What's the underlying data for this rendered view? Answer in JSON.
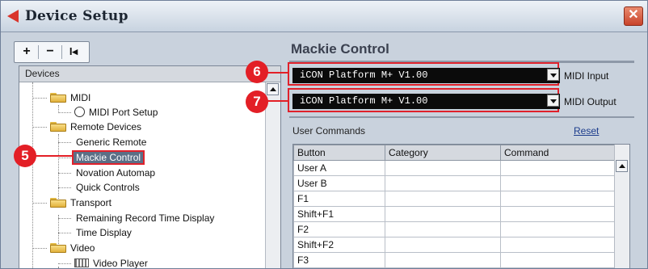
{
  "window": {
    "title": "Device Setup",
    "close_icon": "close-icon"
  },
  "toolbar": {
    "add_label": "+",
    "remove_label": "−",
    "reset_label": "I◂"
  },
  "devices": {
    "header": "Devices",
    "items": {
      "midi": "MIDI",
      "midi_port_setup": "MIDI Port Setup",
      "remote_devices": "Remote Devices",
      "generic_remote": "Generic Remote",
      "mackie_control": "Mackie Control",
      "novation_automap": "Novation Automap",
      "quick_controls": "Quick Controls",
      "transport": "Transport",
      "remaining_record": "Remaining Record Time Display",
      "time_display": "Time Display",
      "video": "Video",
      "video_player": "Video Player"
    }
  },
  "callouts": {
    "c5": "5",
    "c6": "6",
    "c7": "7"
  },
  "panel": {
    "title": "Mackie Control",
    "midi_input": {
      "value": "iCON Platform M+ V1.00",
      "label": "MIDI Input"
    },
    "midi_output": {
      "value": "iCON Platform M+ V1.00",
      "label": "MIDI Output"
    },
    "user_commands_label": "User Commands",
    "reset_label": "Reset"
  },
  "table": {
    "headers": [
      "Button",
      "Category",
      "Command"
    ],
    "rows": [
      "User A",
      "User B",
      "F1",
      "Shift+F1",
      "F2",
      "Shift+F2",
      "F3"
    ]
  },
  "colors": {
    "accent_red": "#e31f26",
    "selection": "#5b6f86",
    "select_bg": "#0b0b0b"
  }
}
